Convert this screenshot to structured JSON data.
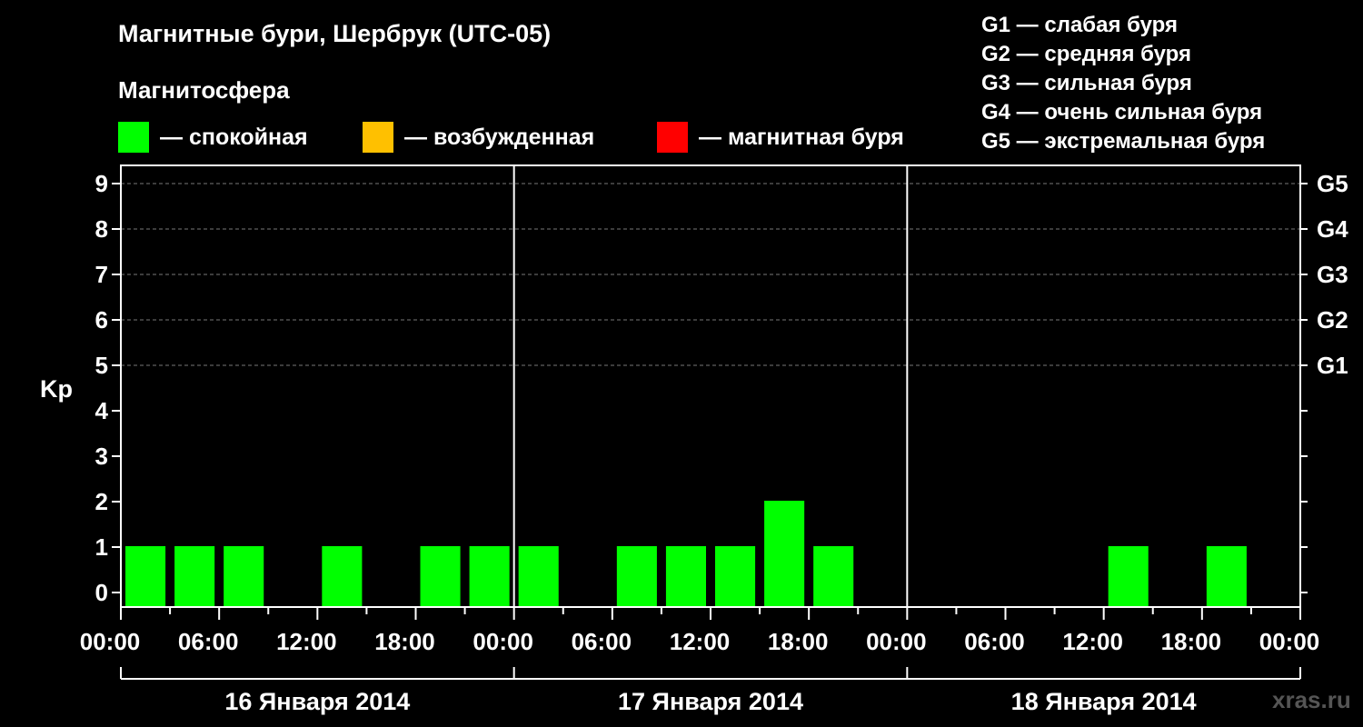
{
  "header": {
    "title": "Магнитные бури, Шербрук (UTC-05)",
    "subtitle": "Магнитосфера"
  },
  "legend": [
    {
      "label": "— спокойная",
      "color": "#00ff00"
    },
    {
      "label": "— возбужденная",
      "color": "#ffc000"
    },
    {
      "label": "— магнитная буря",
      "color": "#ff0000"
    }
  ],
  "g_legend": [
    "G1 — слабая буря",
    "G2 — средняя буря",
    "G3 — сильная буря",
    "G4 — очень сильная буря",
    "G5 — экстремальная буря"
  ],
  "watermark": "xras.ru",
  "chart_data": {
    "type": "bar",
    "ylabel": "Kp",
    "ylim": [
      0,
      9
    ],
    "yticks": [
      "0",
      "1",
      "2",
      "3",
      "4",
      "5",
      "6",
      "7",
      "8",
      "9"
    ],
    "right_axis_labels": [
      {
        "kp": 5,
        "label": "G1"
      },
      {
        "kp": 6,
        "label": "G2"
      },
      {
        "kp": 7,
        "label": "G3"
      },
      {
        "kp": 8,
        "label": "G4"
      },
      {
        "kp": 9,
        "label": "G5"
      }
    ],
    "x_tick_labels": [
      "00:00",
      "06:00",
      "12:00",
      "18:00",
      "00:00",
      "06:00",
      "12:00",
      "18:00",
      "00:00",
      "06:00",
      "12:00",
      "18:00",
      "00:00"
    ],
    "days": [
      "16 Января 2014",
      "17 Января 2014",
      "18 Января 2014"
    ],
    "interval_hours": 3,
    "categories": [
      "16.01 00-03",
      "16.01 03-06",
      "16.01 06-09",
      "16.01 09-12",
      "16.01 12-15",
      "16.01 15-18",
      "16.01 18-21",
      "16.01 21-24",
      "17.01 00-03",
      "17.01 03-06",
      "17.01 06-09",
      "17.01 09-12",
      "17.01 12-15",
      "17.01 15-18",
      "17.01 18-21",
      "17.01 21-24",
      "18.01 00-03",
      "18.01 03-06",
      "18.01 06-09",
      "18.01 09-12",
      "18.01 12-15",
      "18.01 15-18",
      "18.01 18-21",
      "18.01 21-24"
    ],
    "values": [
      1,
      1,
      1,
      null,
      1,
      null,
      1,
      1,
      1,
      null,
      1,
      1,
      1,
      2,
      1,
      null,
      null,
      null,
      null,
      null,
      1,
      null,
      1,
      null
    ],
    "bar_color": "#00ff00",
    "grid_lines_at": [
      5,
      6,
      7,
      8,
      9
    ]
  }
}
